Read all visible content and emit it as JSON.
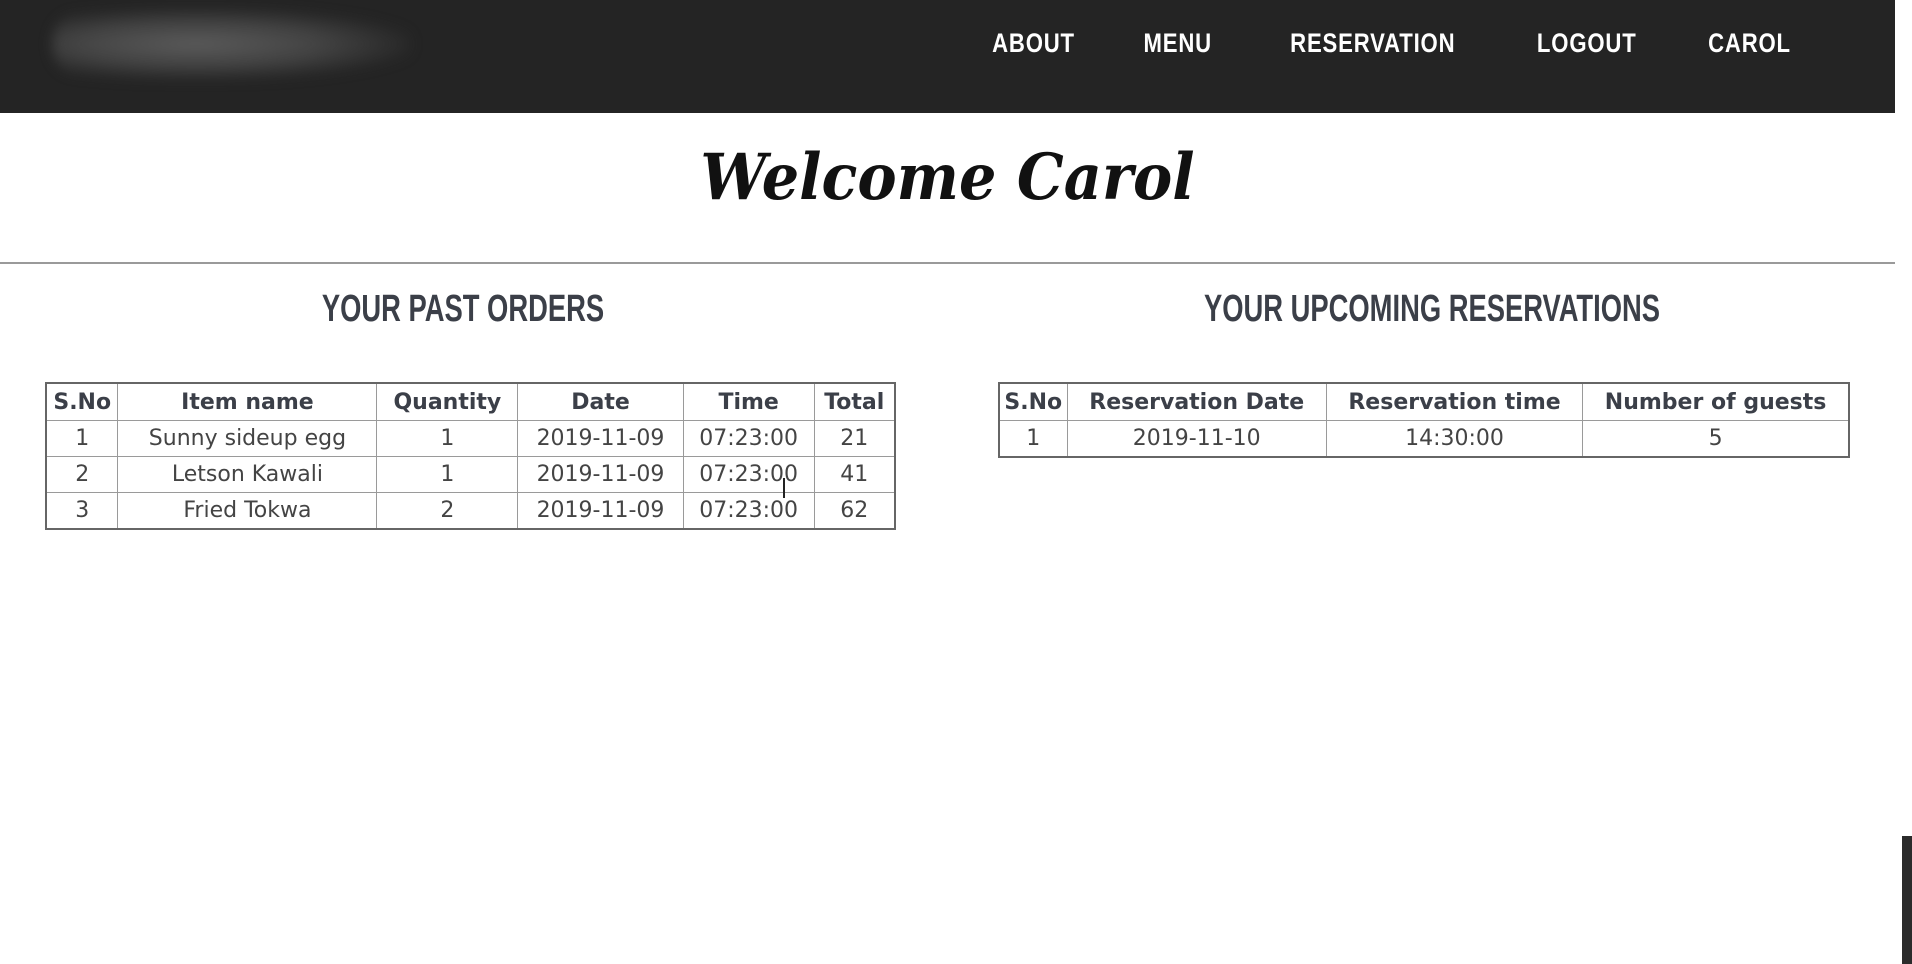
{
  "nav": {
    "items": [
      "ABOUT",
      "MENU",
      "RESERVATION",
      "LOGOUT",
      "CAROL"
    ]
  },
  "welcome": "Welcome Carol",
  "past_orders": {
    "title": "YOUR PAST ORDERS",
    "headers": [
      "S.No",
      "Item name",
      "Quantity",
      "Date",
      "Time",
      "Total"
    ],
    "rows": [
      [
        "1",
        "Sunny sideup egg",
        "1",
        "2019-11-09",
        "07:23:00",
        "21"
      ],
      [
        "2",
        "Letson Kawali",
        "1",
        "2019-11-09",
        "07:23:00",
        "41"
      ],
      [
        "3",
        "Fried Tokwa",
        "2",
        "2019-11-09",
        "07:23:00",
        "62"
      ]
    ]
  },
  "reservations": {
    "title": "YOUR UPCOMING RESERVATIONS",
    "headers": [
      "S.No",
      "Reservation Date",
      "Reservation time",
      "Number of guests"
    ],
    "rows": [
      [
        "1",
        "2019-11-10",
        "14:30:00",
        "5"
      ]
    ]
  },
  "colors": {
    "navbar_bg": "#242424",
    "nav_text": "#ffffff",
    "heading_text": "#3b3f48",
    "table_border": "#9a9a9a"
  }
}
